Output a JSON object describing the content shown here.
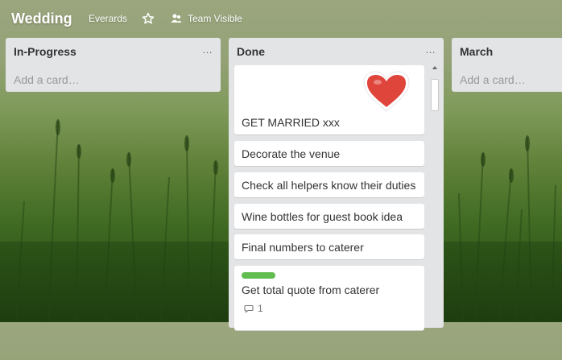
{
  "header": {
    "title": "Wedding",
    "org": "Everards",
    "visibility": "Team Visible"
  },
  "lists": [
    {
      "title": "In-Progress",
      "menu": "…",
      "add_card": "Add a card…"
    },
    {
      "title": "Done",
      "menu": "…",
      "cards": [
        {
          "text": "GET MARRIED xxx",
          "has_heart_image": true
        },
        {
          "text": "Decorate the venue"
        },
        {
          "text": "Check all helpers know their duties"
        },
        {
          "text": "Wine bottles for guest book idea"
        },
        {
          "text": "Final numbers to caterer"
        },
        {
          "text": "Get total quote from caterer",
          "label_color": "#61bd4f",
          "comments": "1"
        }
      ]
    },
    {
      "title": "March",
      "menu": "…",
      "add_card": "Add a card…"
    }
  ],
  "colors": {
    "list_bg": "#e2e4e6",
    "label_green": "#61bd4f",
    "heart": "#e0453c"
  }
}
